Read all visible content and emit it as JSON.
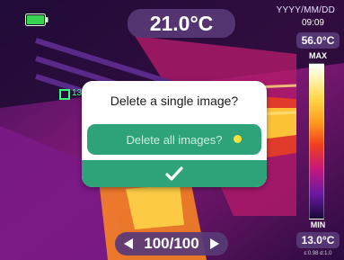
{
  "status": {
    "center_temperature": "21.0°C",
    "date": "YYYY/MM/DD",
    "time": "09:09"
  },
  "scale": {
    "max_temperature": "56.0°C",
    "max_label": "MAX",
    "min_label": "MIN",
    "min_temperature": "13.0°C",
    "params": "ε:0.98 d:1.0"
  },
  "crosshair": {
    "partial_text": "13"
  },
  "dialog": {
    "title": "Delete a single image?",
    "option_label": "Delete all images?",
    "confirm_icon": "checkmark-icon"
  },
  "pager": {
    "counter": "100/100",
    "prev_icon": "triangle-left-icon",
    "next_icon": "triangle-right-icon"
  },
  "colors": {
    "accent_green": "#2ea37a",
    "pill_purple": "#583a76",
    "battery_green": "#39d353",
    "option_dot_yellow": "#f6e23a"
  }
}
